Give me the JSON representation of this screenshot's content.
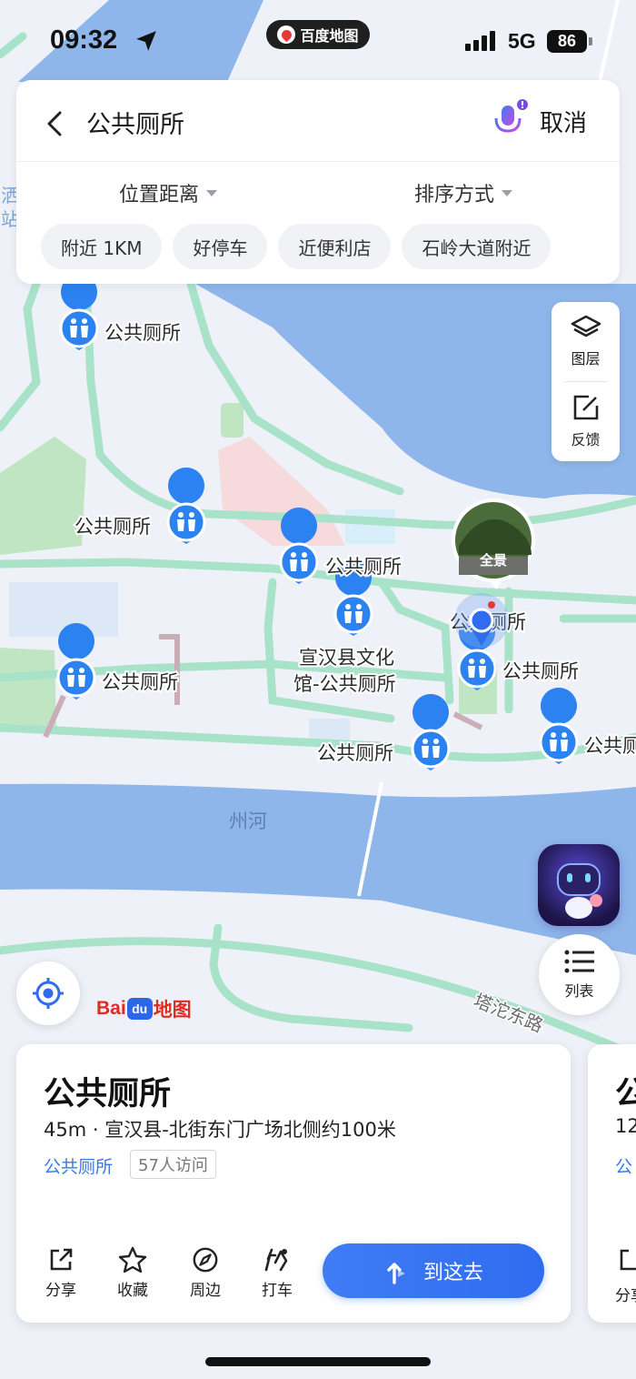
{
  "status_bar": {
    "time": "09:32",
    "network": "5G",
    "battery": "86",
    "app_pill": "百度地图"
  },
  "search": {
    "query": "公共厕所",
    "cancel_label": "取消",
    "filters": [
      "位置距离",
      "排序方式"
    ],
    "chips": [
      "附近 1KM",
      "好停车",
      "近便利店",
      "石岭大道附近"
    ]
  },
  "side_tools": {
    "layers_label": "图层",
    "feedback_label": "反馈"
  },
  "map": {
    "poi_labels": [
      "公共厕所",
      "公共厕所",
      "公共厕所",
      "宣汉县文化",
      "馆-公共厕所",
      "公共厕所",
      "公共厕所",
      "公共厕所",
      "公共厕所",
      "公共厕所",
      "公共厕所"
    ],
    "river_label": "州河",
    "road_label": "塔沱东路",
    "street_view_label": "全景",
    "edge_label_1": "洒",
    "edge_label_2": "站",
    "logo_text_1": "Bai",
    "logo_text_2": "du",
    "logo_text_3": "地图"
  },
  "buttons": {
    "list_label": "列表"
  },
  "card": {
    "title": "公共厕所",
    "address": "45m · 宣汉县-北街东门广场北侧约100米",
    "category": "公共厕所",
    "visits": "57人访问",
    "actions": [
      "分享",
      "收藏",
      "周边",
      "打车"
    ],
    "go_label": "到这去"
  },
  "card2": {
    "title_partial": "公",
    "distance_partial": "12",
    "category_partial": "公",
    "action_partial": "分享"
  },
  "colors": {
    "water": "#8fb6ea",
    "land": "#eef2f8",
    "road": "#a8e3c9",
    "park": "#bfe5c2",
    "accent": "#2f6cf0",
    "poi": "#2c82f0"
  }
}
